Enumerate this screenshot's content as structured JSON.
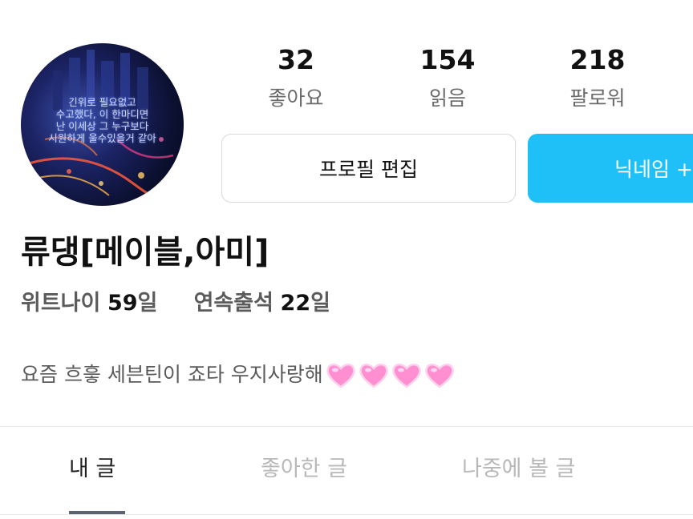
{
  "profile": {
    "avatar_text": [
      "긴위로 필요없고",
      "수고했다, 이 한마디면",
      "난 이세상 그 누구보다",
      "시원하게 울수있을거 같아"
    ],
    "name": "류댕[메이블,아미]",
    "stats": [
      {
        "value": "32",
        "label": "좋아요"
      },
      {
        "value": "154",
        "label": "읽음"
      },
      {
        "value": "218",
        "label": "팔로워"
      }
    ],
    "buttons": {
      "edit_label": "프로필 편집",
      "nickname_label": "닉네임 +"
    },
    "meta": {
      "wattnai_label": "위트나이",
      "wattnai_value": "59",
      "wattnai_unit": "일",
      "streak_label": "연속출석",
      "streak_value": "22",
      "streak_unit": "일"
    },
    "bio": "요즘 흐흫 세븐틴이 죠타 우지사랑해",
    "bio_emoji": "pink-sparkling-heart-icon",
    "bio_emoji_count": 4
  },
  "tabs": [
    {
      "label": "내 글",
      "active": true
    },
    {
      "label": "좋아한 글",
      "active": false
    },
    {
      "label": "나중에 볼 글",
      "active": false
    }
  ],
  "colors": {
    "accent": "#1ec0f7",
    "heart": "#ff8fd0",
    "tab_indicator": "#5c6470"
  }
}
